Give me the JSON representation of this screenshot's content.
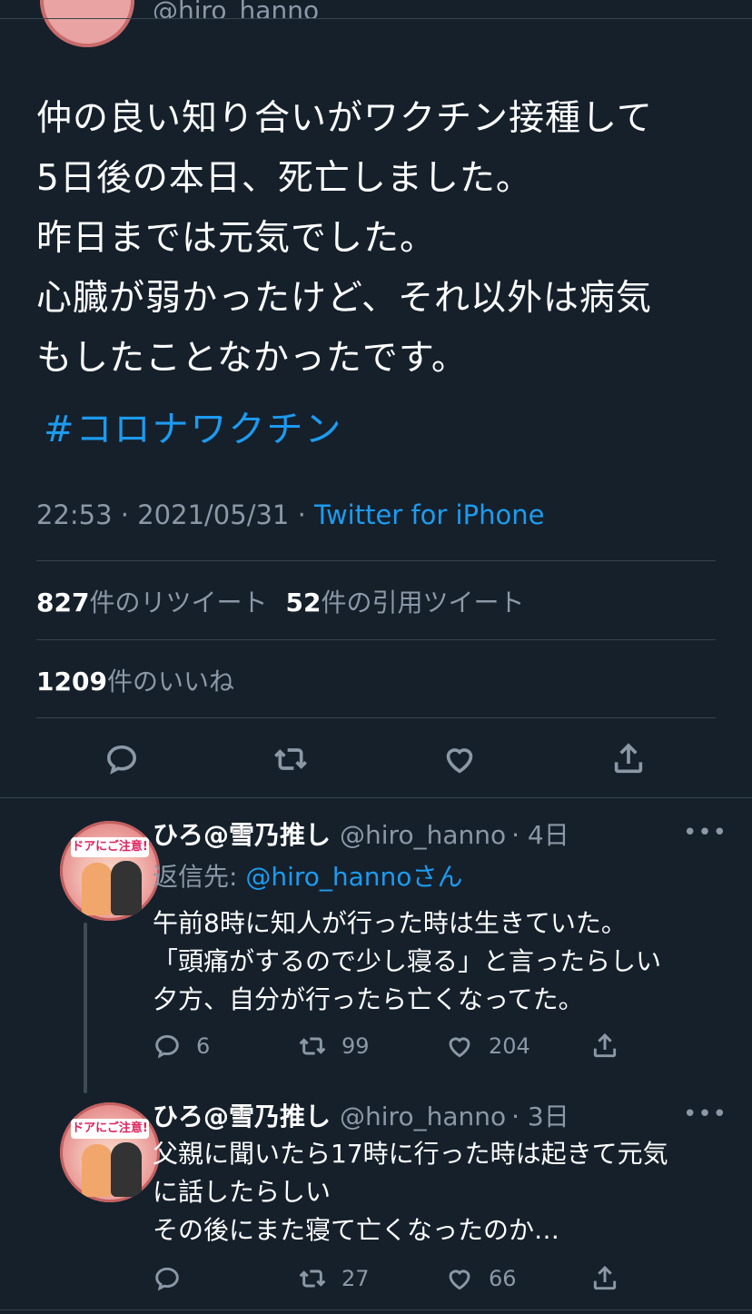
{
  "top": {
    "handle": "@hiro_hanno"
  },
  "tweet": {
    "text": "仲の良い知り合いがワクチン接種して\n5日後の本日、死亡しました。\n昨日までは元気でした。\n心臓が弱かったけど、それ以外は病気\nもしたことなかったです。",
    "hashtag": "#コロナワクチン",
    "time": "22:53 · 2021/05/31 · ",
    "source": "Twitter for iPhone",
    "retweets_count": "827",
    "retweets_label": "件のリツイート",
    "quotes_count": "52",
    "quotes_label": "件の引用ツイート",
    "likes_count": "1209",
    "likes_label": "件のいいね"
  },
  "actions": {
    "icons": [
      "reply-icon",
      "retweet-icon",
      "like-icon",
      "share-icon"
    ]
  },
  "replies": [
    {
      "name": "ひろ@雪乃推し",
      "handle": "@hiro_hanno",
      "time": "· 4日",
      "more": "•••",
      "replying_prefix": "返信先: ",
      "replying_link": "@hiro_hanno",
      "replying_suffix": "さん",
      "avatar_text": "ドアにご注意!",
      "text": "午前8時に知人が行った時は生きていた。\n「頭痛がするので少し寝る」と言ったらしい\n夕方、自分が行ったら亡くなってた。",
      "reply_count": "6",
      "retweet_count": "99",
      "like_count": "204"
    },
    {
      "name": "ひろ@雪乃推し",
      "handle": "@hiro_hanno",
      "time": "· 3日",
      "more": "•••",
      "avatar_text": "ドアにご注意!",
      "text": "父親に聞いたら17時に行った時は起きて元気\nに話したらしい\nその後にまた寝て亡くなったのか…",
      "reply_count": "",
      "retweet_count": "27",
      "like_count": "66"
    }
  ],
  "colors": {
    "background": "#15202b",
    "accent": "#1d9bf0",
    "secondary_text": "#8b98a5",
    "divider": "#38444d"
  }
}
